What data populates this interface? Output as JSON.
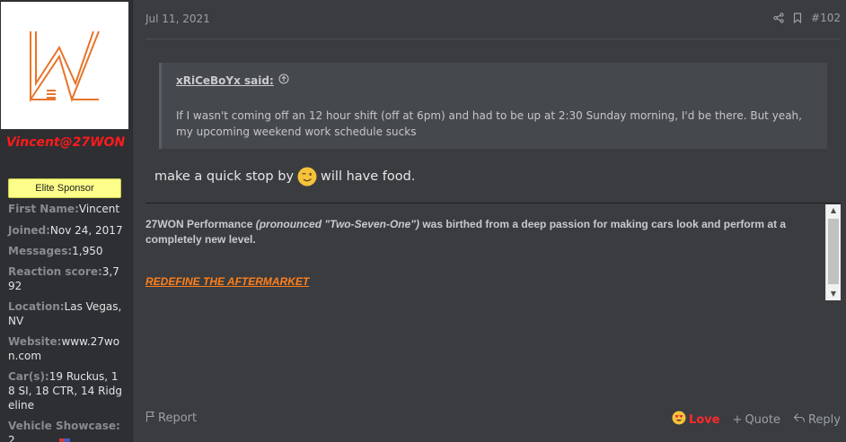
{
  "user": {
    "name": "Vincent@27WON",
    "badge": "Elite Sponsor",
    "stats": [
      {
        "key": "First Name:",
        "value": "Vincent"
      },
      {
        "key": "Joined:",
        "value": "Nov 24, 2017"
      },
      {
        "key": "Messages:",
        "value": "1,950"
      },
      {
        "key": "Reaction score:",
        "value": "3,792"
      },
      {
        "key": "Location:",
        "value": "Las Vegas, NV"
      },
      {
        "key": "Website:",
        "value": "www.27won.com"
      },
      {
        "key": "Car(s):",
        "value": "19 Ruckus, 18 SI, 18 CTR, 14 Ridgeline"
      },
      {
        "key": "Vehicle Showcase:",
        "value": "2"
      }
    ]
  },
  "post": {
    "date": "Jul 11, 2021",
    "number": "#102",
    "quote": {
      "author": "xRiCeBoYx said:",
      "text": "If I wasn't coming off an 12 hour shift (off at 6pm) and had to be up at 2:30 Sunday morning, I'd be there. But yeah, my upcoming weekend work schedule sucks"
    },
    "message_before": "make a quick stop by",
    "message_after": "will have food."
  },
  "signature": {
    "brand": "27WON Performance",
    "pronounced": "(pronounced \"Two-Seven-One\")",
    "rest": "was birthed from a deep passion for making cars look and perform at a completely new level.",
    "link": "REDEFINE THE AFTERMARKET"
  },
  "actions": {
    "report": "Report",
    "love": "Love",
    "quote": "Quote",
    "reply": "Reply"
  },
  "colors": {
    "username": "#ff1a1a",
    "badge_bg": "#fdfd8a",
    "love": "#ff2a2a",
    "sig_link": "#ff7f1a"
  },
  "icons": [
    "share-icon",
    "bookmark-icon",
    "quote-up-arrow-icon",
    "wink-emoji-icon",
    "flag-icon",
    "heart-eyes-emoji-icon",
    "plus-icon",
    "reply-arrow-icon"
  ]
}
